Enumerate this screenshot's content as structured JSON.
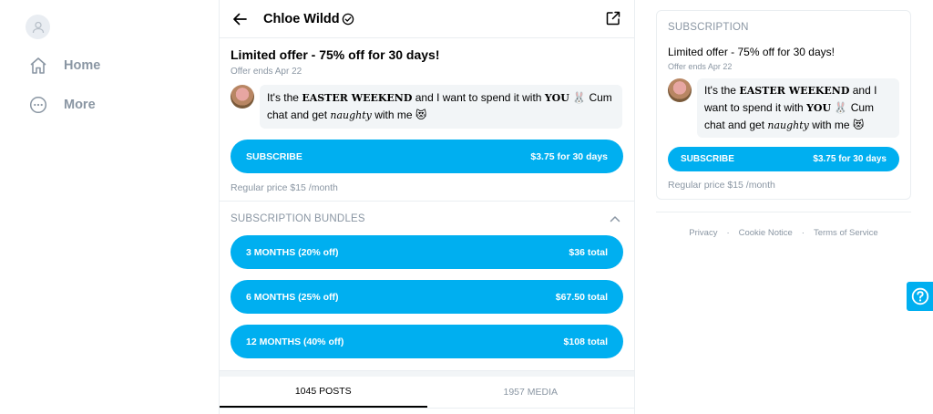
{
  "nav": {
    "home": "Home",
    "more": "More"
  },
  "profile": {
    "name": "Chloe Wildd"
  },
  "offer": {
    "title": "Limited offer - 75% off for 30 days!",
    "ends": "Offer ends Apr 22",
    "message": {
      "part1": "It's the ",
      "bold": "EASTER WEEKEND",
      "part2": " and I want to spend it with ",
      "bold2": "YOU",
      "emoji1": " 🐰 ",
      "part3": "Cum chat and get ",
      "italic": "naughty",
      "part4": " with me ",
      "emoji2": "😻"
    },
    "subscribe_label": "SUBSCRIBE",
    "subscribe_price": "$3.75 for 30 days",
    "regular_price": "Regular price $15 /month"
  },
  "bundles": {
    "title": "SUBSCRIPTION BUNDLES",
    "items": [
      {
        "label": "3 MONTHS (20% off)",
        "price": "$36 total"
      },
      {
        "label": "6 MONTHS (25% off)",
        "price": "$67.50 total"
      },
      {
        "label": "12 MONTHS (40% off)",
        "price": "$108 total"
      }
    ]
  },
  "tabs": {
    "posts": "1045 POSTS",
    "media": "1957 MEDIA",
    "active": "posts"
  },
  "sidebar_card": {
    "heading": "SUBSCRIPTION",
    "title": "Limited offer - 75% off for 30 days!",
    "ends": "Offer ends Apr 22",
    "subscribe_label": "SUBSCRIBE",
    "subscribe_price": "$3.75 for 30 days",
    "regular_price": "Regular price $15 /month"
  },
  "footer": {
    "privacy": "Privacy",
    "cookie": "Cookie Notice",
    "terms": "Terms of Service",
    "separator": "·"
  },
  "colors": {
    "accent": "#00aff0",
    "muted_text": "#8a96a3",
    "divider": "#eaeef1"
  },
  "icons": [
    "user-placeholder-icon",
    "home-icon",
    "more-icon",
    "back-arrow-icon",
    "verified-icon",
    "share-icon",
    "chevron-up-icon",
    "help-icon"
  ]
}
